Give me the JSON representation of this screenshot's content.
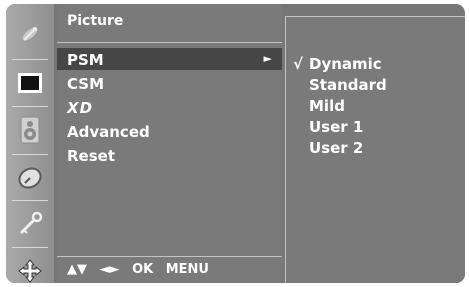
{
  "sidebar": {
    "icons": [
      "satellite-icon",
      "picture-icon",
      "speaker-icon",
      "clock-icon",
      "key-icon",
      "option-icon"
    ]
  },
  "menu": {
    "title": "Picture",
    "items": [
      {
        "label": "PSM",
        "selected": true,
        "has_submenu": true
      },
      {
        "label": "CSM",
        "selected": false
      },
      {
        "label": "XD",
        "selected": false
      },
      {
        "label": "Advanced",
        "selected": false
      },
      {
        "label": "Reset",
        "selected": false
      }
    ],
    "submenu_arrow": "►"
  },
  "navigation_hint": {
    "updown": "▲▼",
    "leftright": "◄►",
    "ok": "OK",
    "menu": "MENU"
  },
  "submenu": {
    "check_mark": "√",
    "options": [
      {
        "label": "Dynamic",
        "checked": true
      },
      {
        "label": "Standard",
        "checked": false
      },
      {
        "label": "Mild",
        "checked": false
      },
      {
        "label": "User 1",
        "checked": false
      },
      {
        "label": "User 2",
        "checked": false
      }
    ]
  },
  "colors": {
    "panel": "#7a7a7a",
    "highlight": "#464646",
    "text": "#ffffff"
  }
}
